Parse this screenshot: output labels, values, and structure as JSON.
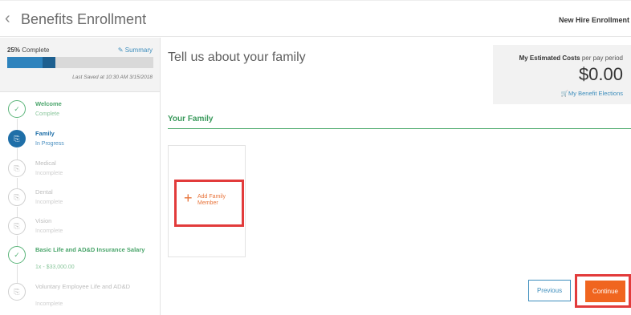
{
  "header": {
    "back_icon": "chevron-left-icon",
    "title": "Benefits Enrollment",
    "context_label": "New Hire Enrollment"
  },
  "sidebar": {
    "progress": {
      "percent_text": "25%",
      "complete_word": "Complete",
      "summary_label": "Summary",
      "summary_icon": "edit-icon",
      "fill_fraction": 0.33,
      "last_saved": "Last Saved at 10:30 AM 3/15/2018"
    },
    "steps": [
      {
        "name": "Welcome",
        "status": "Complete",
        "state": "done",
        "icon": "check-icon"
      },
      {
        "name": "Family",
        "status": "In Progress",
        "state": "active",
        "icon": "clipboard-icon"
      },
      {
        "name": "Medical",
        "status": "Incomplete",
        "state": "pending",
        "icon": "clipboard-icon"
      },
      {
        "name": "Dental",
        "status": "Incomplete",
        "state": "pending",
        "icon": "clipboard-icon"
      },
      {
        "name": "Vision",
        "status": "Incomplete",
        "state": "pending",
        "icon": "clipboard-icon"
      },
      {
        "name": "Basic Life and AD&D Insurance Salary",
        "status": "1x - $33,000.00",
        "state": "done",
        "icon": "check-icon"
      },
      {
        "name": "Voluntary Employee Life and AD&D",
        "status": "Incomplete",
        "state": "pending",
        "icon": "clipboard-icon"
      }
    ]
  },
  "main": {
    "heading": "Tell us about your family",
    "costs": {
      "label_bold": "My Estimated Costs",
      "label_rest": " per pay period",
      "amount": "$0.00",
      "elections_label": "My Benefit Elections",
      "elections_icon": "cart-icon"
    },
    "section_title": "Your Family",
    "add_member": {
      "label": "Add Family Member",
      "icon": "plus-icon"
    },
    "buttons": {
      "previous": "Previous",
      "continue": "Continue"
    }
  },
  "colors": {
    "accent_blue": "#2e83bd",
    "success_green": "#4aa56b",
    "cta_orange": "#f0651f",
    "highlight_red": "#e23b3b"
  }
}
